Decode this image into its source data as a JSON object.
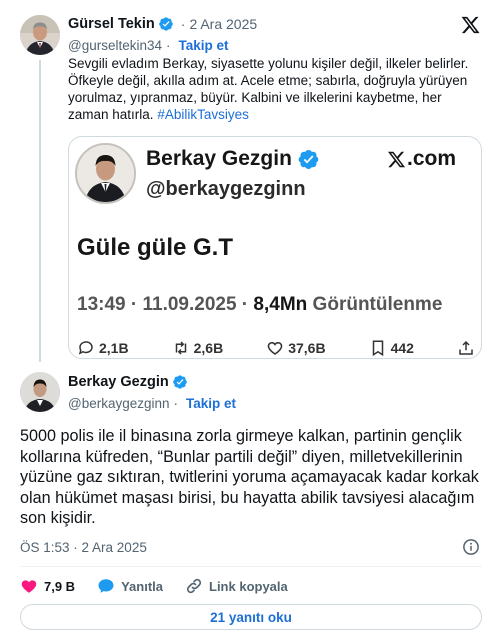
{
  "quoted_tweet": {
    "author_name": "Gürsel Tekin",
    "handle": "@gurseltekin34",
    "date": "2 Ara 2025",
    "follow_label": "Takip et",
    "text": "Sevgili evladım Berkay, siyasette yolunu kişiler değil, ilkeler belirler. Öfkeyle değil, akılla adım at. Acele etme; sabırla, doğruyla yürüyen yorulmaz, yıpranmaz, büyür. Kalbini ve ilkelerini kaybetme, her zaman hatırla.",
    "hashtag": "#AbilikTavsiyes",
    "embed": {
      "name": "Berkay Gezgin",
      "handle": "@berkaygezginn",
      "site": ".com",
      "body": "Güle güle G.T",
      "time_date": "13:49 · 11.09.2025 · ",
      "views": "8,4Mn",
      "views_label": " Görüntülenme",
      "replies": "2,1B",
      "reposts": "2,6B",
      "likes": "37,6B",
      "bookmarks": "442"
    }
  },
  "main_tweet": {
    "author_name": "Berkay Gezgin",
    "handle": "@berkaygezginn",
    "follow_label": "Takip et",
    "text": "5000 polis ile il binasına zorla girmeye kalkan, partinin gençlik kollarına küfreden, “Bunlar partili değil” diyen, milletvekillerinin yüzüne gaz sıktıran, twitlerini yoruma açamayacak kadar korkak olan hükümet maşası birisi, bu hayatta abilik tavsiyesi alacağım son kişidir.",
    "timestamp": "ÖS 1:53 · 2 Ara 2025",
    "likes": "7,9 B",
    "reply_label": "Yanıtla",
    "copy_link_label": "Link kopyala",
    "read_replies_label": "21 yanıtı oku"
  },
  "colors": {
    "verified_blue": "#1d9bf0",
    "link_blue": "#1d6fd8",
    "like_pink": "#f91880",
    "muted_gray": "#536471"
  },
  "icons": [
    "verified-badge-icon",
    "x-logo-icon",
    "info-icon",
    "heart-icon",
    "reply-icon",
    "link-icon",
    "repost-icon",
    "bookmark-icon",
    "share-icon"
  ]
}
